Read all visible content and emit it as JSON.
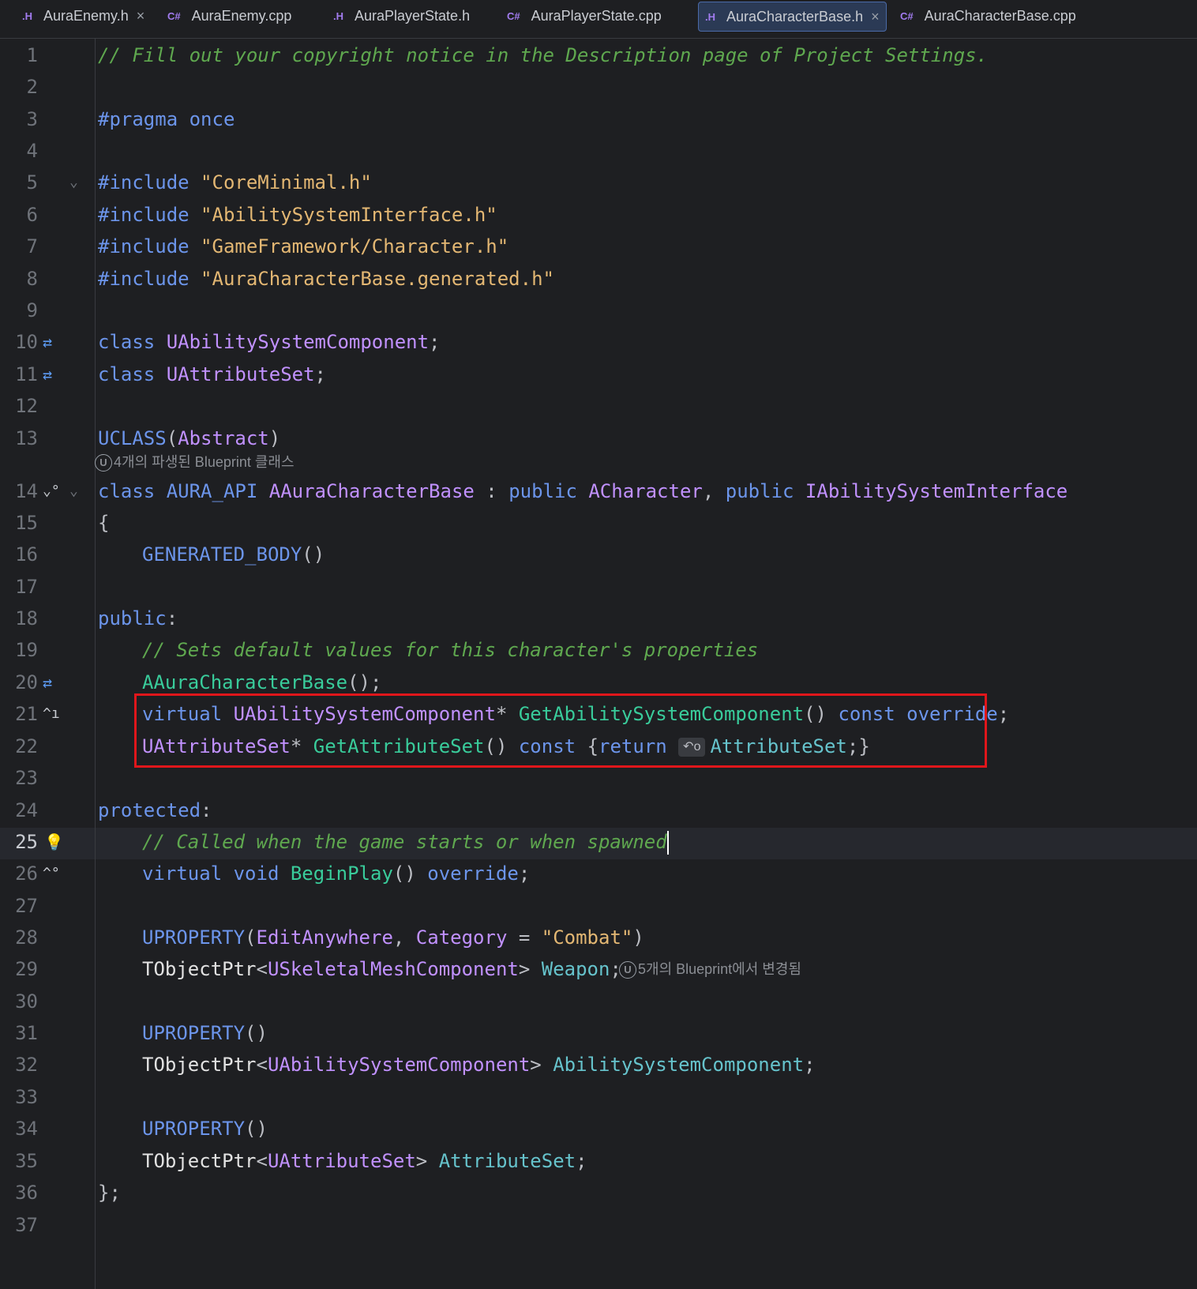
{
  "tabs": [
    {
      "icon": ".H",
      "label": "AuraEnemy.h",
      "closable": true,
      "active": false
    },
    {
      "icon": "C#",
      "label": "AuraEnemy.cpp",
      "closable": false,
      "active": false
    },
    {
      "icon": ".H",
      "label": "AuraPlayerState.h",
      "closable": false,
      "active": false
    },
    {
      "icon": "C#",
      "label": "AuraPlayerState.cpp",
      "closable": false,
      "active": false
    },
    {
      "icon": ".H",
      "label": "AuraCharacterBase.h",
      "closable": true,
      "active": true
    },
    {
      "icon": "C#",
      "label": "AuraCharacterBase.cpp",
      "closable": false,
      "active": false
    }
  ],
  "close_glyph": "×",
  "line_numbers": [
    "1",
    "2",
    "3",
    "4",
    "5",
    "6",
    "7",
    "8",
    "9",
    "10",
    "11",
    "12",
    "13",
    "14",
    "15",
    "16",
    "17",
    "18",
    "19",
    "20",
    "21",
    "22",
    "23",
    "24",
    "25",
    "26",
    "27",
    "28",
    "29",
    "30",
    "31",
    "32",
    "33",
    "34",
    "35",
    "36",
    "37"
  ],
  "code": {
    "l1": "// Fill out your copyright notice in the Description page of Project Settings.",
    "l3_kw": "#pragma",
    "l3_rest": " once",
    "include": "#include",
    "l5_str": "\"CoreMinimal.h\"",
    "l6_str": "\"AbilitySystemInterface.h\"",
    "l7_str": "\"GameFramework/Character.h\"",
    "l8_str": "\"AuraCharacterBase.generated.h\"",
    "class_kw": "class",
    "l10_cls": "UAbilitySystemComponent",
    "l11_cls": "UAttributeSet",
    "semi": ";",
    "l13_mac": "UCLASS",
    "l13_arg": "Abstract",
    "l13_hint_badge": "U",
    "l13_hint": "4개의 파생된 Blueprint 클래스",
    "l14_api": "AURA_API",
    "l14_cls": "AAuraCharacterBase",
    "l14_colon": " : ",
    "public_kw": "public",
    "l14_base1": "ACharacter",
    "l14_comma": ", ",
    "l14_base2": "IAbilitySystemInterface",
    "l15": "{",
    "l16_mac": "GENERATED_BODY",
    "parens": "()",
    "l18_kw": "public",
    "colon": ":",
    "l19": "// Sets default values for this character's properties",
    "l20_fn": "AAuraCharacterBase",
    "l20_tail": "();",
    "virtual_kw": "virtual",
    "l21_cls": "UAbilitySystemComponent",
    "star": "*",
    "l21_fn": "GetAbilitySystemComponent",
    "const_kw": "const",
    "override_kw": "override",
    "l22_cls": "UAttributeSet",
    "l22_fn": "GetAttributeSet",
    "l22_brace": "{",
    "return_kw": "return",
    "l22_hint": "↶o",
    "l22_var": "AttributeSet",
    "l22_tail": ";}",
    "l24_kw": "protected",
    "l25": "// Called when the game starts or when spawned",
    "void_kw": "void",
    "l26_fn": "BeginPlay",
    "l28_mac": "UPROPERTY",
    "l28_open": "(",
    "l28_arg1": "EditAnywhere",
    "l28_comma": ", ",
    "l28_arg2": "Category",
    "l28_eq": " = ",
    "l28_str": "\"Combat\"",
    "l28_close": ")",
    "tobjptr": "TObjectPtr",
    "lt": "<",
    "gt": ">",
    "l29_cls": "USkeletalMeshComponent",
    "l29_var": "Weapon",
    "l29_hint_badge": "U",
    "l29_hint": "5개의 Blueprint에서 변경됨",
    "l32_cls": "UAbilitySystemComponent",
    "l32_var": "AbilitySystemComponent",
    "l35_cls": "UAttributeSet",
    "l35_var": "AttributeSet",
    "l36": "};"
  },
  "icons": {
    "fold": "chevron-down-icon",
    "override_swap": "swap-arrows-icon",
    "implements": "implements-icon",
    "bulb": "lightbulb-icon"
  },
  "colors": {
    "highlight_box": "#e0161b",
    "comment": "#5fa84f",
    "keyword": "#6c95eb",
    "string": "#e3b773",
    "class": "#c191ff",
    "function": "#39cc9b"
  }
}
